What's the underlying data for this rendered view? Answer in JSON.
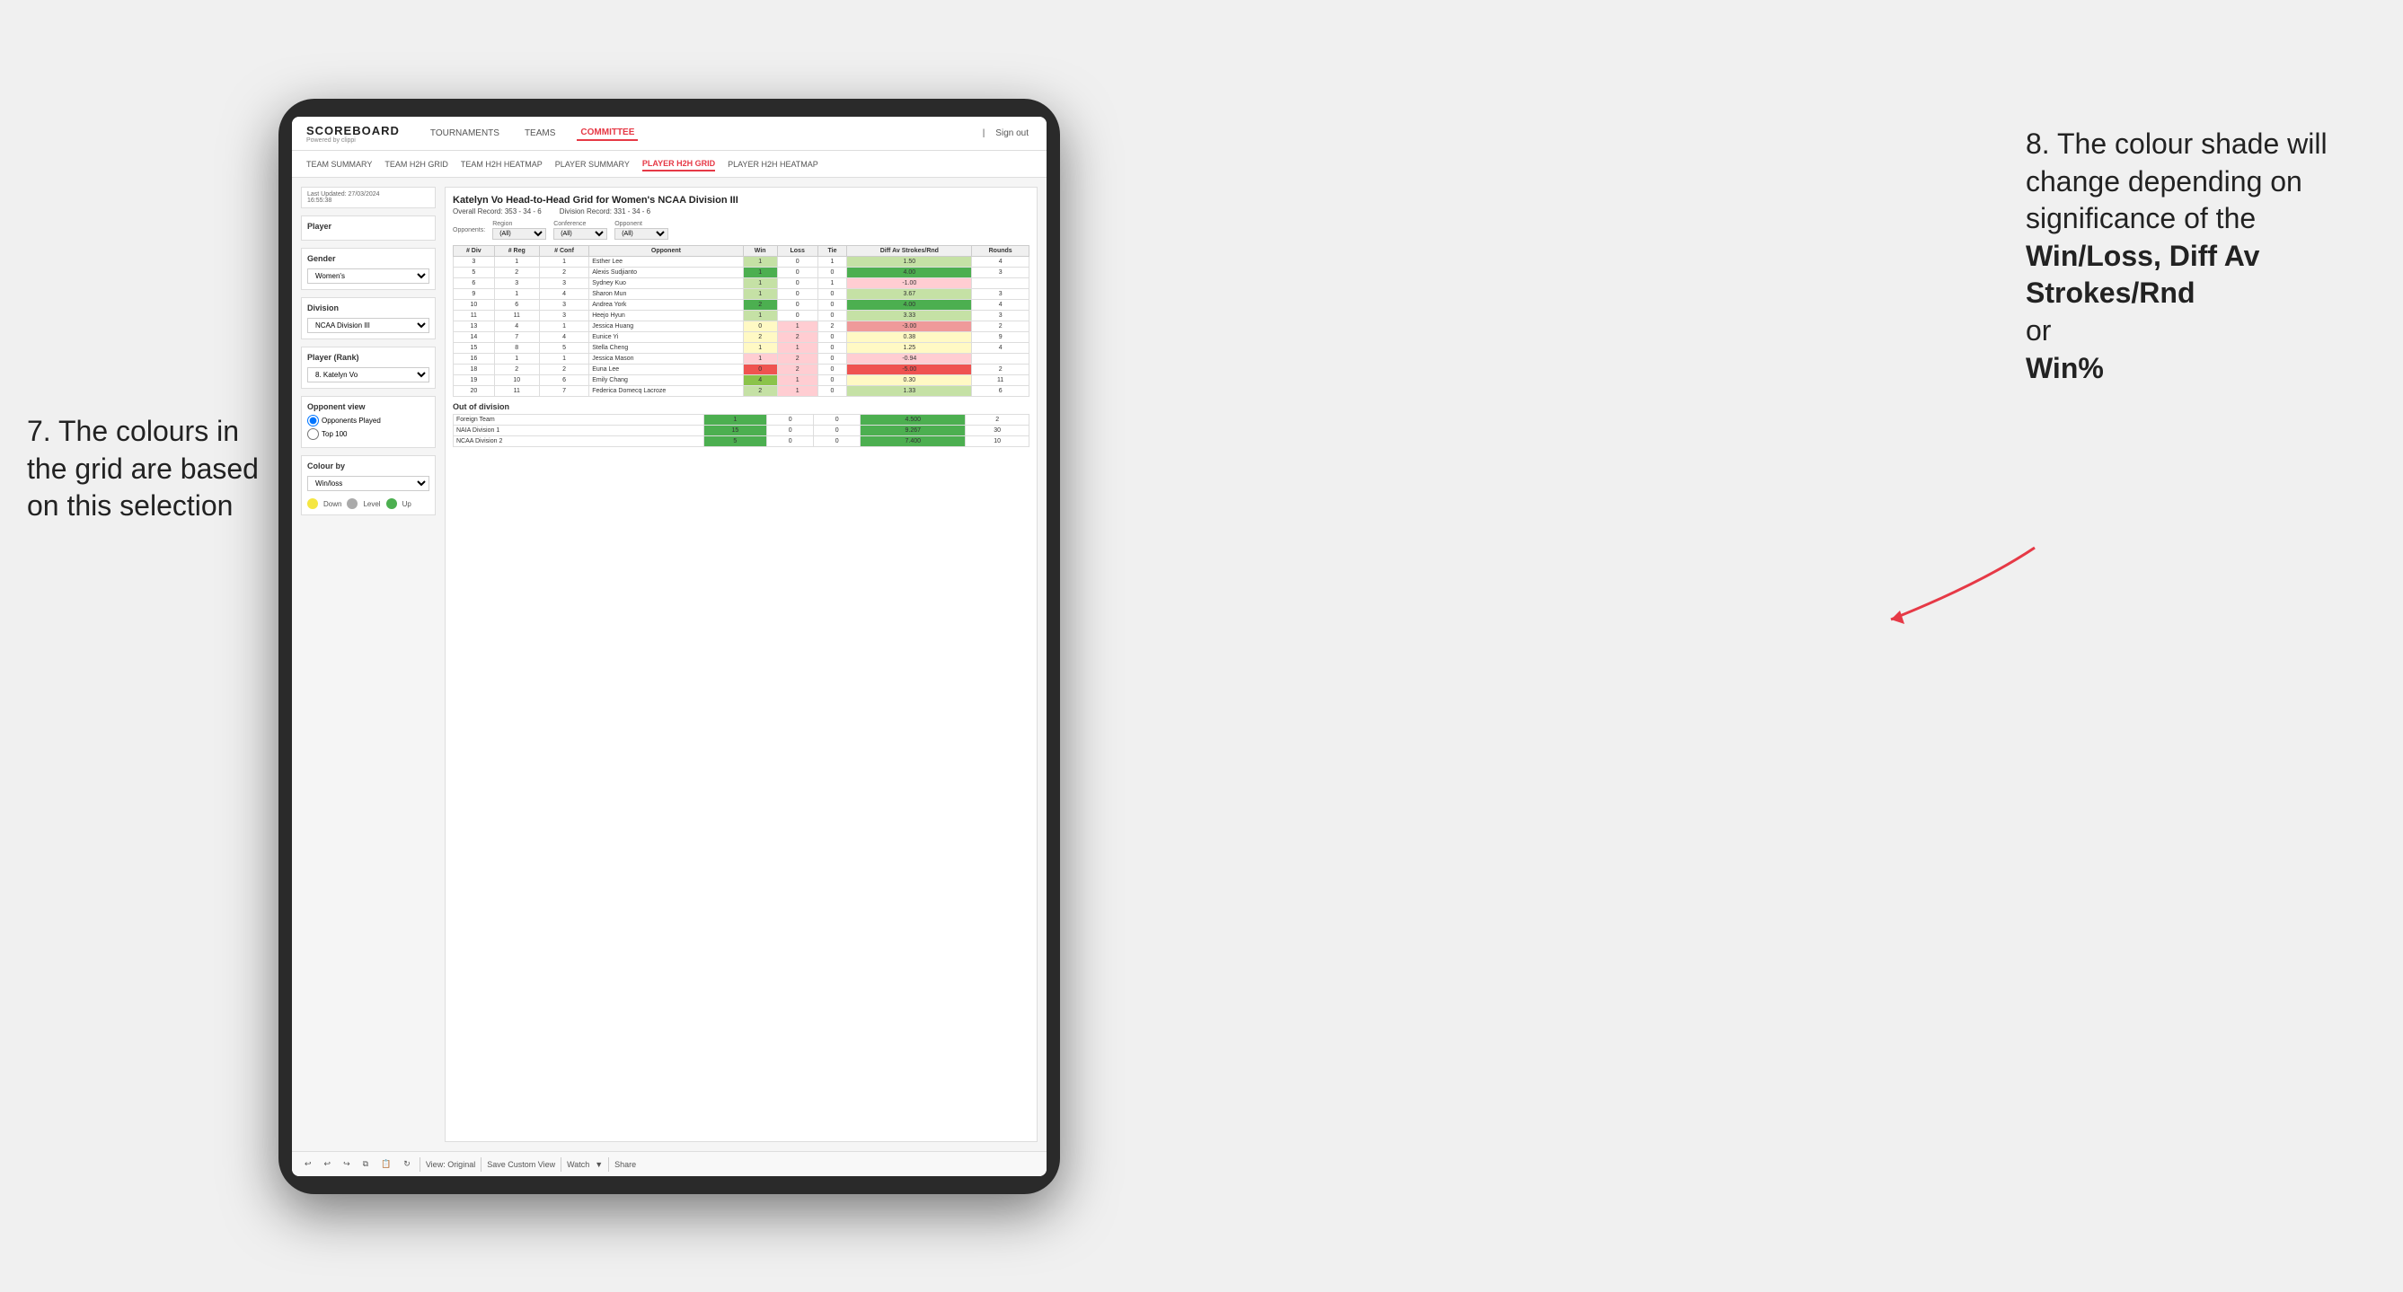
{
  "annotations": {
    "left_title": "7. The colours in the grid are based on this selection",
    "right_title": "8. The colour shade will change depending on significance of the",
    "right_bold1": "Win/Loss,",
    "right_bold2": "Diff Av Strokes/Rnd",
    "right_or": "or",
    "right_bold3": "Win%"
  },
  "nav": {
    "logo": "SCOREBOARD",
    "logo_sub": "Powered by clippi",
    "items": [
      "TOURNAMENTS",
      "TEAMS",
      "COMMITTEE"
    ],
    "active": "COMMITTEE",
    "sign_in": "Sign out"
  },
  "sub_nav": {
    "items": [
      "TEAM SUMMARY",
      "TEAM H2H GRID",
      "TEAM H2H HEATMAP",
      "PLAYER SUMMARY",
      "PLAYER H2H GRID",
      "PLAYER H2H HEATMAP"
    ],
    "active": "PLAYER H2H GRID"
  },
  "sidebar": {
    "last_updated_label": "Last Updated: 27/03/2024",
    "last_updated_time": "16:55:38",
    "player_label": "Player",
    "gender_label": "Gender",
    "gender_value": "Women's",
    "division_label": "Division",
    "division_value": "NCAA Division III",
    "player_rank_label": "Player (Rank)",
    "player_rank_value": "8. Katelyn Vo",
    "opponent_view_label": "Opponent view",
    "radio1": "Opponents Played",
    "radio2": "Top 100",
    "colour_by_label": "Colour by",
    "colour_by_value": "Win/loss",
    "legend_down": "Down",
    "legend_level": "Level",
    "legend_up": "Up"
  },
  "grid": {
    "title": "Katelyn Vo Head-to-Head Grid for Women's NCAA Division III",
    "overall_record_label": "Overall Record:",
    "overall_record_value": "353 - 34 - 6",
    "division_record_label": "Division Record:",
    "division_record_value": "331 - 34 - 6",
    "filter_opponents_label": "Opponents:",
    "filter_region_label": "Region",
    "filter_region_value": "(All)",
    "filter_conference_label": "Conference",
    "filter_conference_value": "(All)",
    "filter_opponent_label": "Opponent",
    "filter_opponent_value": "(All)",
    "columns": [
      "# Div",
      "# Reg",
      "# Conf",
      "Opponent",
      "Win",
      "Loss",
      "Tie",
      "Diff Av Strokes/Rnd",
      "Rounds"
    ],
    "rows": [
      {
        "div": "3",
        "reg": "1",
        "conf": "1",
        "opponent": "Esther Lee",
        "win": 1,
        "loss": 0,
        "tie": 1,
        "diff": "1.50",
        "rounds": "4",
        "win_color": "green-light",
        "diff_color": "green-light"
      },
      {
        "div": "5",
        "reg": "2",
        "conf": "2",
        "opponent": "Alexis Sudjianto",
        "win": 1,
        "loss": 0,
        "tie": 0,
        "diff": "4.00",
        "rounds": "3",
        "win_color": "green-dark",
        "diff_color": "green-dark"
      },
      {
        "div": "6",
        "reg": "3",
        "conf": "3",
        "opponent": "Sydney Kuo",
        "win": 1,
        "loss": 0,
        "tie": 1,
        "diff": "-1.00",
        "rounds": "",
        "win_color": "green-light",
        "diff_color": "red-light"
      },
      {
        "div": "9",
        "reg": "1",
        "conf": "4",
        "opponent": "Sharon Mun",
        "win": 1,
        "loss": 0,
        "tie": 0,
        "diff": "3.67",
        "rounds": "3",
        "win_color": "green-light",
        "diff_color": "green-light"
      },
      {
        "div": "10",
        "reg": "6",
        "conf": "3",
        "opponent": "Andrea York",
        "win": 2,
        "loss": 0,
        "tie": 0,
        "diff": "4.00",
        "rounds": "4",
        "win_color": "green-dark",
        "diff_color": "green-dark"
      },
      {
        "div": "11",
        "reg": "11",
        "conf": "3",
        "opponent": "Heejo Hyun",
        "win": 1,
        "loss": 0,
        "tie": 0,
        "diff": "3.33",
        "rounds": "3",
        "win_color": "green-light",
        "diff_color": "green-light"
      },
      {
        "div": "13",
        "reg": "4",
        "conf": "1",
        "opponent": "Jessica Huang",
        "win": 0,
        "loss": 1,
        "tie": 2,
        "diff": "-3.00",
        "rounds": "2",
        "win_color": "yellow",
        "diff_color": "red-med"
      },
      {
        "div": "14",
        "reg": "7",
        "conf": "4",
        "opponent": "Eunice Yi",
        "win": 2,
        "loss": 2,
        "tie": 0,
        "diff": "0.38",
        "rounds": "9",
        "win_color": "yellow",
        "diff_color": "yellow"
      },
      {
        "div": "15",
        "reg": "8",
        "conf": "5",
        "opponent": "Stella Cheng",
        "win": 1,
        "loss": 1,
        "tie": 0,
        "diff": "1.25",
        "rounds": "4",
        "win_color": "yellow",
        "diff_color": "yellow"
      },
      {
        "div": "16",
        "reg": "1",
        "conf": "1",
        "opponent": "Jessica Mason",
        "win": 1,
        "loss": 2,
        "tie": 0,
        "diff": "-0.94",
        "rounds": "",
        "win_color": "red-light",
        "diff_color": "red-light"
      },
      {
        "div": "18",
        "reg": "2",
        "conf": "2",
        "opponent": "Euna Lee",
        "win": 0,
        "loss": 2,
        "tie": 0,
        "diff": "-5.00",
        "rounds": "2",
        "win_color": "red-dark",
        "diff_color": "red-dark"
      },
      {
        "div": "19",
        "reg": "10",
        "conf": "6",
        "opponent": "Emily Chang",
        "win": 4,
        "loss": 1,
        "tie": 0,
        "diff": "0.30",
        "rounds": "11",
        "win_color": "green-med",
        "diff_color": "yellow"
      },
      {
        "div": "20",
        "reg": "11",
        "conf": "7",
        "opponent": "Federica Domecq Lacroze",
        "win": 2,
        "loss": 1,
        "tie": 0,
        "diff": "1.33",
        "rounds": "6",
        "win_color": "green-light",
        "diff_color": "green-light"
      }
    ],
    "out_of_division_label": "Out of division",
    "out_rows": [
      {
        "label": "Foreign Team",
        "win": 1,
        "loss": 0,
        "tie": 0,
        "diff": "4.500",
        "rounds": "2",
        "win_color": "green-dark"
      },
      {
        "label": "NAIA Division 1",
        "win": 15,
        "loss": 0,
        "tie": 0,
        "diff": "9.267",
        "rounds": "30",
        "win_color": "green-dark"
      },
      {
        "label": "NCAA Division 2",
        "win": 5,
        "loss": 0,
        "tie": 0,
        "diff": "7.400",
        "rounds": "10",
        "win_color": "green-dark"
      }
    ]
  },
  "toolbar": {
    "view_original": "View: Original",
    "save_custom": "Save Custom View",
    "watch": "Watch",
    "share": "Share"
  }
}
